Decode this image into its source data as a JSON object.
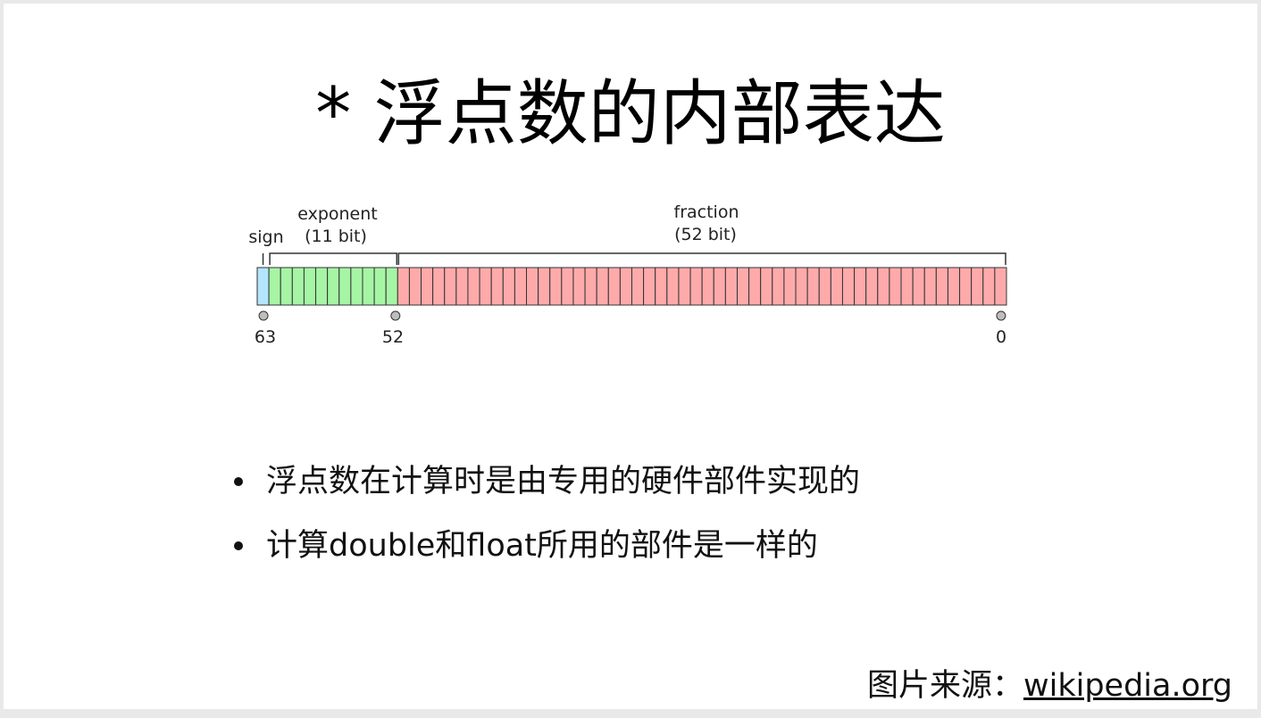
{
  "slide": {
    "title": "* 浮点数的内部表达"
  },
  "diagram": {
    "labels": {
      "sign": "sign",
      "exponent": "exponent",
      "exponent_bits": "(11 bit)",
      "fraction": "fraction",
      "fraction_bits": "(52 bit)"
    },
    "bit_markers": [
      "63",
      "52",
      "0"
    ],
    "fields": [
      {
        "name": "sign",
        "bits": 1,
        "color": "#b3e5fc"
      },
      {
        "name": "exponent",
        "bits": 11,
        "color": "#a5f5a5"
      },
      {
        "name": "fraction",
        "bits": 52,
        "color": "#ffaaaa"
      }
    ],
    "total_bits": 64
  },
  "bullets": [
    "浮点数在计算时是由专用的硬件部件实现的",
    "计算double和float所用的部件是一样的"
  ],
  "source": {
    "label": "图片来源：",
    "link": "wikipedia.org"
  }
}
